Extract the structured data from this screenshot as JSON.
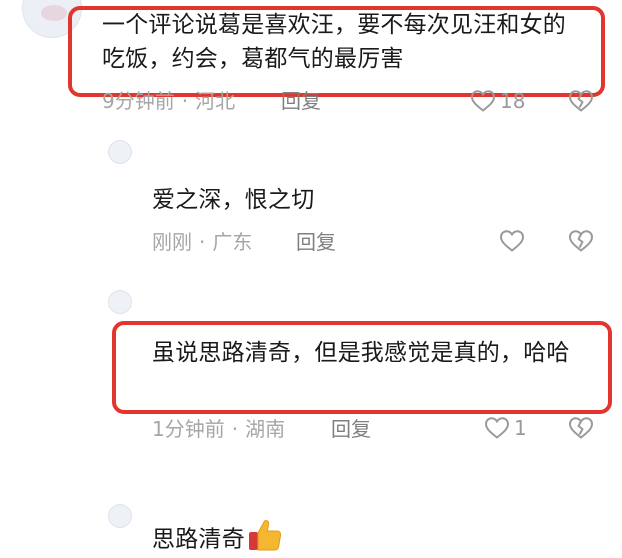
{
  "comments": [
    {
      "text": "一个评论说葛是喜欢汪，要不每次见汪和女的吃饭，约会，葛都气的最厉害",
      "time": "9分钟前",
      "location": "河北",
      "reply_label": "回复",
      "like_count": "18",
      "highlighted": true
    },
    {
      "text": "爱之深，恨之切",
      "time": "刚刚",
      "location": "广东",
      "reply_label": "回复",
      "like_count": "",
      "highlighted": false
    },
    {
      "text": "虽说思路清奇，但是我感觉是真的，哈哈",
      "time": "1分钟前",
      "location": "湖南",
      "reply_label": "回复",
      "like_count": "1",
      "highlighted": true
    },
    {
      "text": "思路清奇",
      "emoji": "thumbs-up-icon",
      "highlighted": false
    }
  ],
  "colors": {
    "highlight_border": "#e2352d",
    "text": "#1a1a1a",
    "meta_text": "#a6a6a6",
    "icon": "#9a9a9a"
  },
  "separator": "·"
}
